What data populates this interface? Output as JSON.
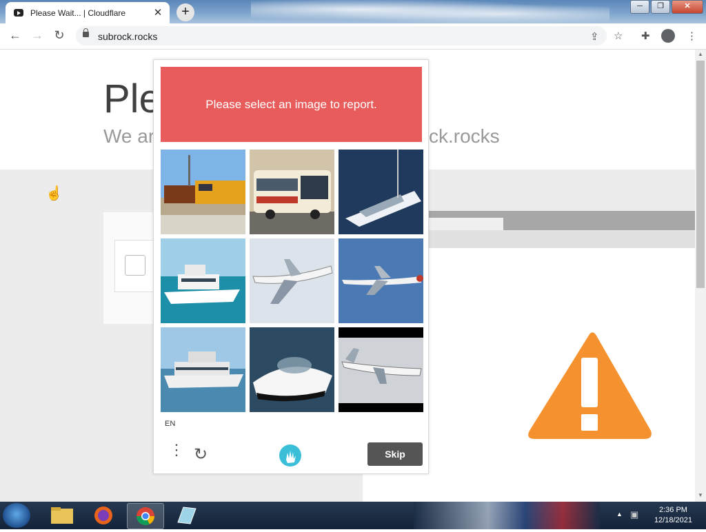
{
  "browser": {
    "tab_title": "Please Wait... | Cloudflare",
    "tab_close": "✕",
    "new_tab": "+",
    "url": "subrock.rocks",
    "window_min": "─",
    "window_max": "❐",
    "window_close": "✕"
  },
  "page": {
    "heading": "Ple",
    "subtitle_left": "We ar",
    "subtitle_right": "ck.rocks"
  },
  "captcha": {
    "prompt": "Please select an image to report.",
    "images": [
      {
        "subject": "train"
      },
      {
        "subject": "bus"
      },
      {
        "subject": "boat"
      },
      {
        "subject": "boat"
      },
      {
        "subject": "airplane"
      },
      {
        "subject": "airplane"
      },
      {
        "subject": "boat"
      },
      {
        "subject": "boat"
      },
      {
        "subject": "airplane"
      }
    ],
    "language": "EN",
    "menu_icon": "⋮",
    "refresh_icon": "↻",
    "skip_label": "Skip"
  },
  "taskbar": {
    "time": "2:36 PM",
    "date": "12/18/2021"
  }
}
